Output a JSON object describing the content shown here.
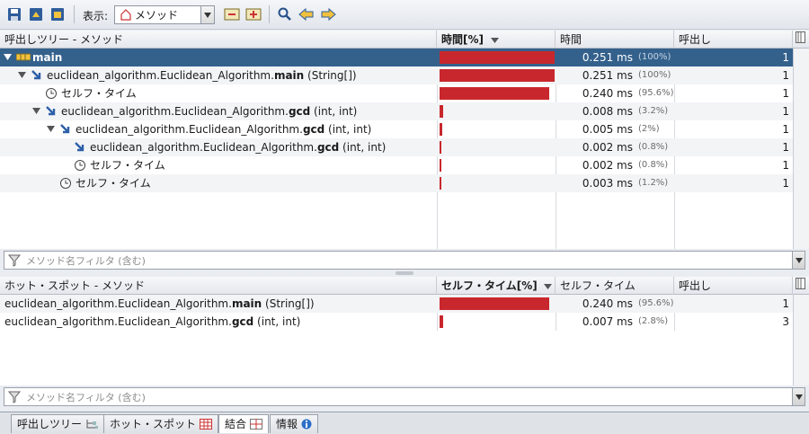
{
  "toolbar": {
    "view_label": "表示:",
    "view_value": "メソッド",
    "icons": [
      "save-icon",
      "export-icon",
      "snapshot-icon",
      "view-combo-icon",
      "collapse-icon",
      "expand-icon",
      "search-icon",
      "back-icon",
      "forward-icon"
    ]
  },
  "calltree": {
    "columns": [
      "呼出しツリー - メソッド",
      "時間[%]",
      "時間",
      "呼出し"
    ],
    "rows": [
      {
        "name": "main",
        "sig": "",
        "bold": "main",
        "time": "0.251 ms",
        "pct": "(100%)",
        "calls": "1",
        "bar": 1.0
      },
      {
        "name": "euclidean_algorithm.Euclidean_Algorithm.",
        "bold": "main",
        "sig": " (String[])",
        "time": "0.251 ms",
        "pct": "(100%)",
        "calls": "1",
        "bar": 1.0
      },
      {
        "name": "セルフ・タイム",
        "bold": "",
        "sig": "",
        "time": "0.240 ms",
        "pct": "(95.6%)",
        "calls": "1",
        "bar": 0.956
      },
      {
        "name": "euclidean_algorithm.Euclidean_Algorithm.",
        "bold": "gcd",
        "sig": " (int, int)",
        "time": "0.008 ms",
        "pct": "(3.2%)",
        "calls": "1",
        "bar": 0.032
      },
      {
        "name": "euclidean_algorithm.Euclidean_Algorithm.",
        "bold": "gcd",
        "sig": " (int, int)",
        "time": "0.005 ms",
        "pct": "(2%)",
        "calls": "1",
        "bar": 0.02
      },
      {
        "name": "euclidean_algorithm.Euclidean_Algorithm.",
        "bold": "gcd",
        "sig": " (int, int)",
        "time": "0.002 ms",
        "pct": "(0.8%)",
        "calls": "1",
        "bar": 0.008
      },
      {
        "name": "セルフ・タイム",
        "bold": "",
        "sig": "",
        "time": "0.002 ms",
        "pct": "(0.8%)",
        "calls": "1",
        "bar": 0.008
      },
      {
        "name": "セルフ・タイム",
        "bold": "",
        "sig": "",
        "time": "0.003 ms",
        "pct": "(1.2%)",
        "calls": "1",
        "bar": 0.012
      }
    ],
    "filter_placeholder": "メソッド名フィルタ (含む)"
  },
  "hotspots": {
    "columns": [
      "ホット・スポット - メソッド",
      "セルフ・タイム[%]",
      "セルフ・タイム",
      "呼出し"
    ],
    "rows": [
      {
        "name": "euclidean_algorithm.Euclidean_Algorithm.",
        "bold": "main",
        "sig": " (String[])",
        "time": "0.240 ms",
        "pct": "(95.6%)",
        "calls": "1",
        "bar": 0.956
      },
      {
        "name": "euclidean_algorithm.Euclidean_Algorithm.",
        "bold": "gcd",
        "sig": " (int, int)",
        "time": "0.007 ms",
        "pct": "(2.8%)",
        "calls": "3",
        "bar": 0.028
      }
    ],
    "filter_placeholder": "メソッド名フィルタ (含む)"
  },
  "tabs": [
    {
      "label": "呼出しツリー",
      "icon": "tree-icon"
    },
    {
      "label": "ホット・スポット",
      "icon": "table-icon"
    },
    {
      "label": "結合",
      "icon": "combined-icon"
    },
    {
      "label": "情報",
      "icon": "info-icon"
    }
  ],
  "colors": {
    "bar": "#c8282d",
    "selection": "#34618c"
  }
}
